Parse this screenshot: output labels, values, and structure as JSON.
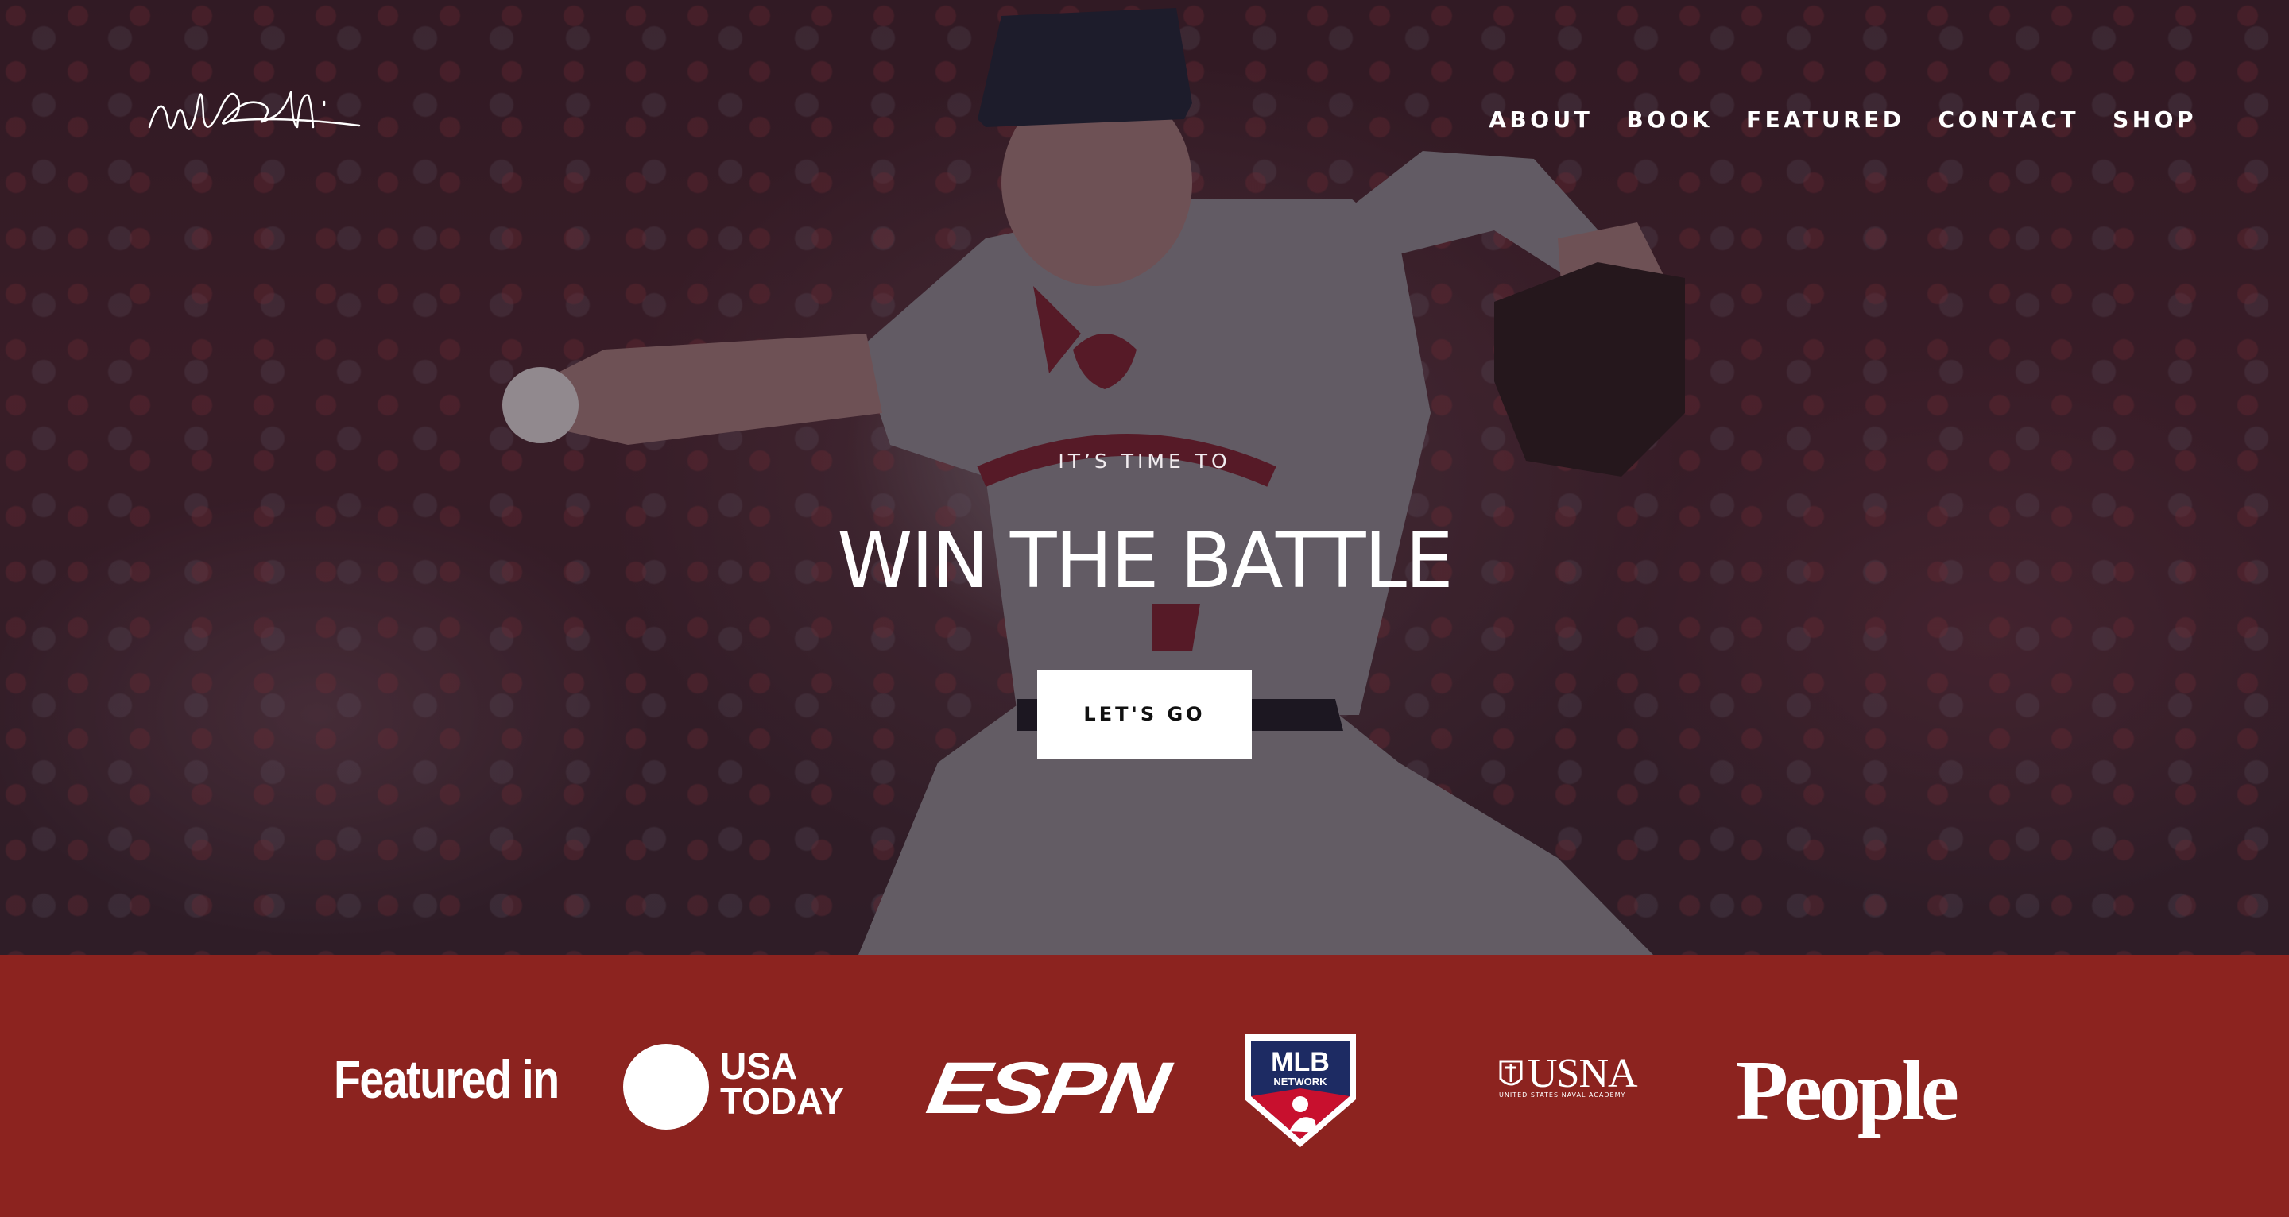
{
  "nav": {
    "items": [
      {
        "label": "ABOUT"
      },
      {
        "label": "BOOK"
      },
      {
        "label": "FEATURED"
      },
      {
        "label": "CONTACT"
      },
      {
        "label": "SHOP"
      }
    ]
  },
  "hero": {
    "eyebrow": "IT’S TIME TO",
    "headline": "WIN THE BATTLE",
    "cta_label": "LET'S GO"
  },
  "featured": {
    "label": "Featured in",
    "logos": {
      "usa_today": "USA TODAY",
      "espn": "ESPN",
      "mlb_network": "MLB NETWORK",
      "usna": "USNA",
      "usna_sub": "UNITED STATES NAVAL ACADEMY",
      "people": "People"
    }
  },
  "colors": {
    "featured_bar": "#8c231f",
    "text": "#ffffff",
    "cta_bg": "#ffffff"
  },
  "icons": [
    "signature-logo",
    "usa-today-logo",
    "espn-logo",
    "mlb-network-logo",
    "usna-logo",
    "people-logo"
  ]
}
